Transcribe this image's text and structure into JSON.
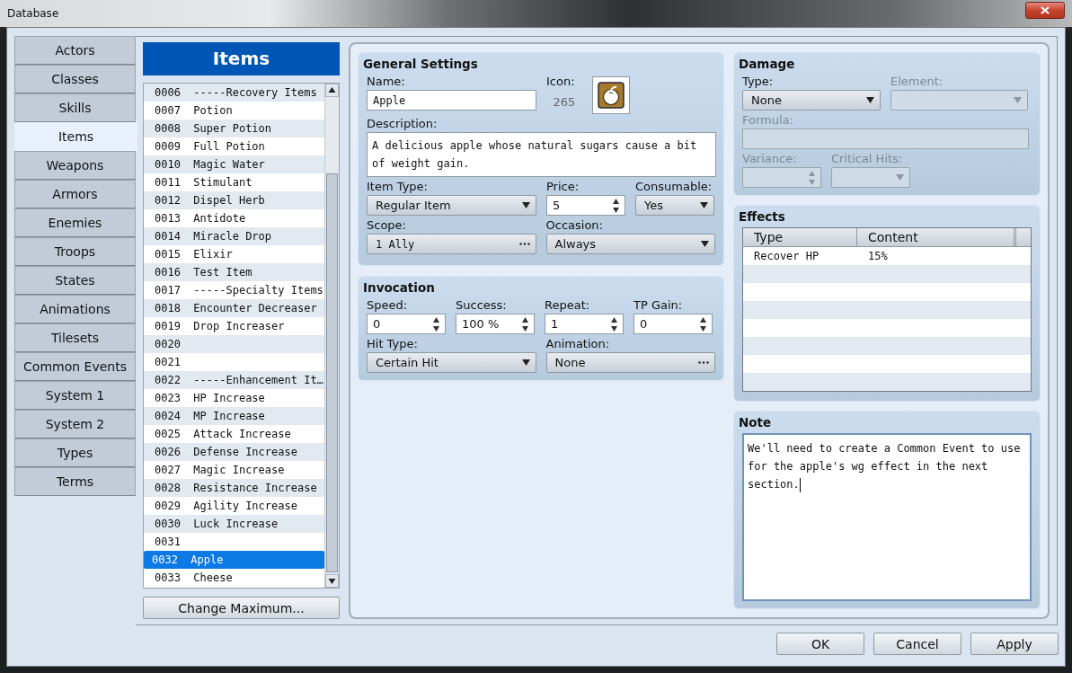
{
  "window": {
    "title": "Database"
  },
  "tabs": [
    {
      "label": "Actors",
      "selected": false
    },
    {
      "label": "Classes",
      "selected": false
    },
    {
      "label": "Skills",
      "selected": false
    },
    {
      "label": "Items",
      "selected": true
    },
    {
      "label": "Weapons",
      "selected": false
    },
    {
      "label": "Armors",
      "selected": false
    },
    {
      "label": "Enemies",
      "selected": false
    },
    {
      "label": "Troops",
      "selected": false
    },
    {
      "label": "States",
      "selected": false
    },
    {
      "label": "Animations",
      "selected": false
    },
    {
      "label": "Tilesets",
      "selected": false
    },
    {
      "label": "Common Events",
      "selected": false
    },
    {
      "label": "System 1",
      "selected": false
    },
    {
      "label": "System 2",
      "selected": false
    },
    {
      "label": "Types",
      "selected": false
    },
    {
      "label": "Terms",
      "selected": false
    }
  ],
  "list": {
    "title": "Items",
    "rows": [
      {
        "id": "0006",
        "name": "-----Recovery Items",
        "selected": false
      },
      {
        "id": "0007",
        "name": "Potion",
        "selected": false
      },
      {
        "id": "0008",
        "name": "Super Potion",
        "selected": false
      },
      {
        "id": "0009",
        "name": "Full Potion",
        "selected": false
      },
      {
        "id": "0010",
        "name": "Magic Water",
        "selected": false
      },
      {
        "id": "0011",
        "name": "Stimulant",
        "selected": false
      },
      {
        "id": "0012",
        "name": "Dispel Herb",
        "selected": false
      },
      {
        "id": "0013",
        "name": "Antidote",
        "selected": false
      },
      {
        "id": "0014",
        "name": "Miracle Drop",
        "selected": false
      },
      {
        "id": "0015",
        "name": "Elixir",
        "selected": false
      },
      {
        "id": "0016",
        "name": "Test Item",
        "selected": false
      },
      {
        "id": "0017",
        "name": "-----Specialty Items",
        "selected": false
      },
      {
        "id": "0018",
        "name": "Encounter Decreaser",
        "selected": false
      },
      {
        "id": "0019",
        "name": "Drop Increaser",
        "selected": false
      },
      {
        "id": "0020",
        "name": "",
        "selected": false
      },
      {
        "id": "0021",
        "name": "",
        "selected": false
      },
      {
        "id": "0022",
        "name": "-----Enhancement It…",
        "selected": false
      },
      {
        "id": "0023",
        "name": "HP Increase",
        "selected": false
      },
      {
        "id": "0024",
        "name": "MP Increase",
        "selected": false
      },
      {
        "id": "0025",
        "name": "Attack Increase",
        "selected": false
      },
      {
        "id": "0026",
        "name": "Defense Increase",
        "selected": false
      },
      {
        "id": "0027",
        "name": "Magic Increase",
        "selected": false
      },
      {
        "id": "0028",
        "name": "Resistance Increase",
        "selected": false
      },
      {
        "id": "0029",
        "name": "Agility Increase",
        "selected": false
      },
      {
        "id": "0030",
        "name": "Luck Increase",
        "selected": false
      },
      {
        "id": "0031",
        "name": "",
        "selected": false
      },
      {
        "id": "0032",
        "name": "Apple",
        "selected": true
      },
      {
        "id": "0033",
        "name": "Cheese",
        "selected": false
      }
    ],
    "button": "Change Maximum..."
  },
  "general": {
    "title": "General Settings",
    "name": {
      "label": "Name:",
      "value": "Apple"
    },
    "icon": {
      "label": "Icon:",
      "index": "265"
    },
    "description": {
      "label": "Description:",
      "value": "A delicious apple whose natural sugars cause a bit of weight gain."
    },
    "item_type": {
      "label": "Item Type:",
      "value": "Regular Item",
      "kind": "select"
    },
    "price": {
      "label": "Price:",
      "value": "5",
      "kind": "spin"
    },
    "consumable": {
      "label": "Consumable:",
      "value": "Yes",
      "kind": "select"
    },
    "scope": {
      "label": "Scope:",
      "value": "1 Ally",
      "kind": "picker"
    },
    "occasion": {
      "label": "Occasion:",
      "value": "Always",
      "kind": "select"
    }
  },
  "invocation": {
    "title": "Invocation",
    "speed": {
      "label": "Speed:",
      "value": "0",
      "kind": "spin"
    },
    "success": {
      "label": "Success:",
      "value": "100 %",
      "kind": "spin"
    },
    "repeat": {
      "label": "Repeat:",
      "value": "1",
      "kind": "spin"
    },
    "tp_gain": {
      "label": "TP Gain:",
      "value": "0",
      "kind": "spin"
    },
    "hit_type": {
      "label": "Hit Type:",
      "value": "Certain Hit",
      "kind": "select"
    },
    "animation": {
      "label": "Animation:",
      "value": "None",
      "kind": "picker"
    }
  },
  "damage": {
    "title": "Damage",
    "type": {
      "label": "Type:",
      "value": "None",
      "kind": "select",
      "disabled": false
    },
    "element": {
      "label": "Element:",
      "kind": "select",
      "disabled": true
    },
    "formula": {
      "label": "Formula:",
      "kind": "text",
      "disabled": true
    },
    "variance": {
      "label": "Variance:",
      "kind": "spin",
      "disabled": true
    },
    "critical_hits": {
      "label": "Critical Hits:",
      "kind": "select",
      "disabled": true
    }
  },
  "effects": {
    "title": "Effects",
    "columns": [
      "Type",
      "Content"
    ],
    "rows": [
      {
        "type": "Recover HP",
        "content": "15%"
      }
    ]
  },
  "note": {
    "title": "Note",
    "value": "We'll need to create a Common Event to use for the apple's wg effect in the next section."
  },
  "buttons": [
    "OK",
    "Cancel",
    "Apply"
  ]
}
